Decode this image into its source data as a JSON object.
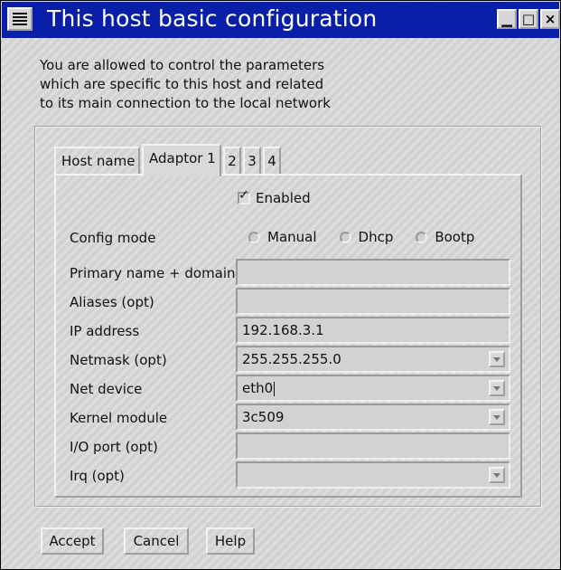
{
  "window": {
    "title": "This host basic configuration"
  },
  "titlebar": {
    "minimize_glyph": "▁",
    "maximize_glyph": "□",
    "close_glyph": "×"
  },
  "intro": [
    "You are allowed to control the parameters",
    "which are specific to this host and related",
    "to its main connection to the local network"
  ],
  "tabs": [
    "Host name",
    "Adaptor 1",
    "2",
    "3",
    "4"
  ],
  "active_tab": "Adaptor 1",
  "enabled": {
    "label": "Enabled",
    "checked": true
  },
  "config_mode": {
    "label": "Config mode",
    "options": [
      "Manual",
      "Dhcp",
      "Bootp"
    ],
    "selected": null
  },
  "fields": {
    "primary_name": {
      "label": "Primary name + domain",
      "value": ""
    },
    "aliases": {
      "label": "Aliases (opt)",
      "value": ""
    },
    "ip_address": {
      "label": "IP address",
      "value": "192.168.3.1"
    },
    "netmask": {
      "label": "Netmask (opt)",
      "value": "255.255.255.0"
    },
    "net_device": {
      "label": "Net device",
      "value": "eth0"
    },
    "kernel_module": {
      "label": "Kernel module",
      "value": "3c509"
    },
    "io_port": {
      "label": "I/O port (opt)",
      "value": ""
    },
    "irq": {
      "label": "Irq (opt)",
      "value": ""
    }
  },
  "buttons": {
    "accept": "Accept",
    "cancel": "Cancel",
    "help": "Help"
  },
  "colors": {
    "titlebar": "#0a1fa8",
    "window_bg": "#d9d9d9"
  }
}
